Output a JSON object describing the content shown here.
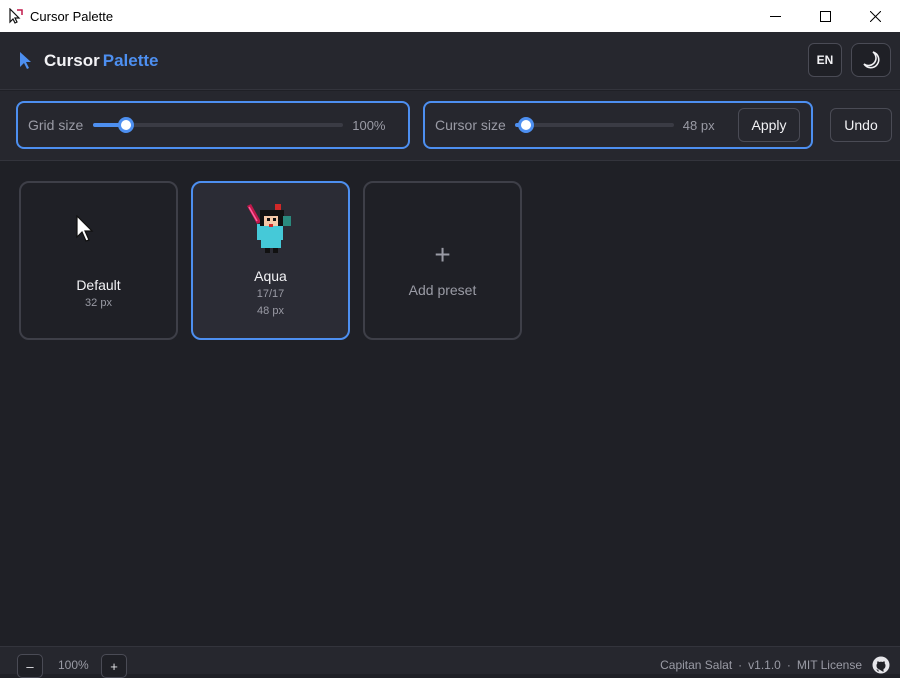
{
  "window": {
    "title": "Cursor Palette",
    "minimize_icon": "minimize-icon",
    "maximize_icon": "maximize-icon",
    "close_icon": "close-icon"
  },
  "header": {
    "brand_part1": "Cursor",
    "brand_part2": "Palette",
    "language": "EN",
    "theme_icon": "moon-icon"
  },
  "controls": {
    "grid_size": {
      "label": "Grid size",
      "value": "100%",
      "level": 0.13
    },
    "cursor_size": {
      "label": "Cursor size",
      "value": "48 px",
      "level": 0.07
    },
    "apply_label": "Apply",
    "undo_label": "Undo"
  },
  "presets": [
    {
      "name": "Default",
      "size": "32 px",
      "active": false
    },
    {
      "name": "Aqua",
      "count": "17/17",
      "size": "48 px",
      "active": true
    }
  ],
  "add_preset": {
    "symbol": "+",
    "label": "Add preset"
  },
  "footer": {
    "zoom_out": "–",
    "zoom": "100%",
    "zoom_in": "+",
    "author": "Capitan Salat",
    "sep1": "·",
    "version": "v1.1.0",
    "sep2": "·",
    "license": "MIT License",
    "github_icon": "github-icon"
  },
  "colors": {
    "accent": "#4d8ff0",
    "background": "#1f2026",
    "surface": "#26272e"
  }
}
